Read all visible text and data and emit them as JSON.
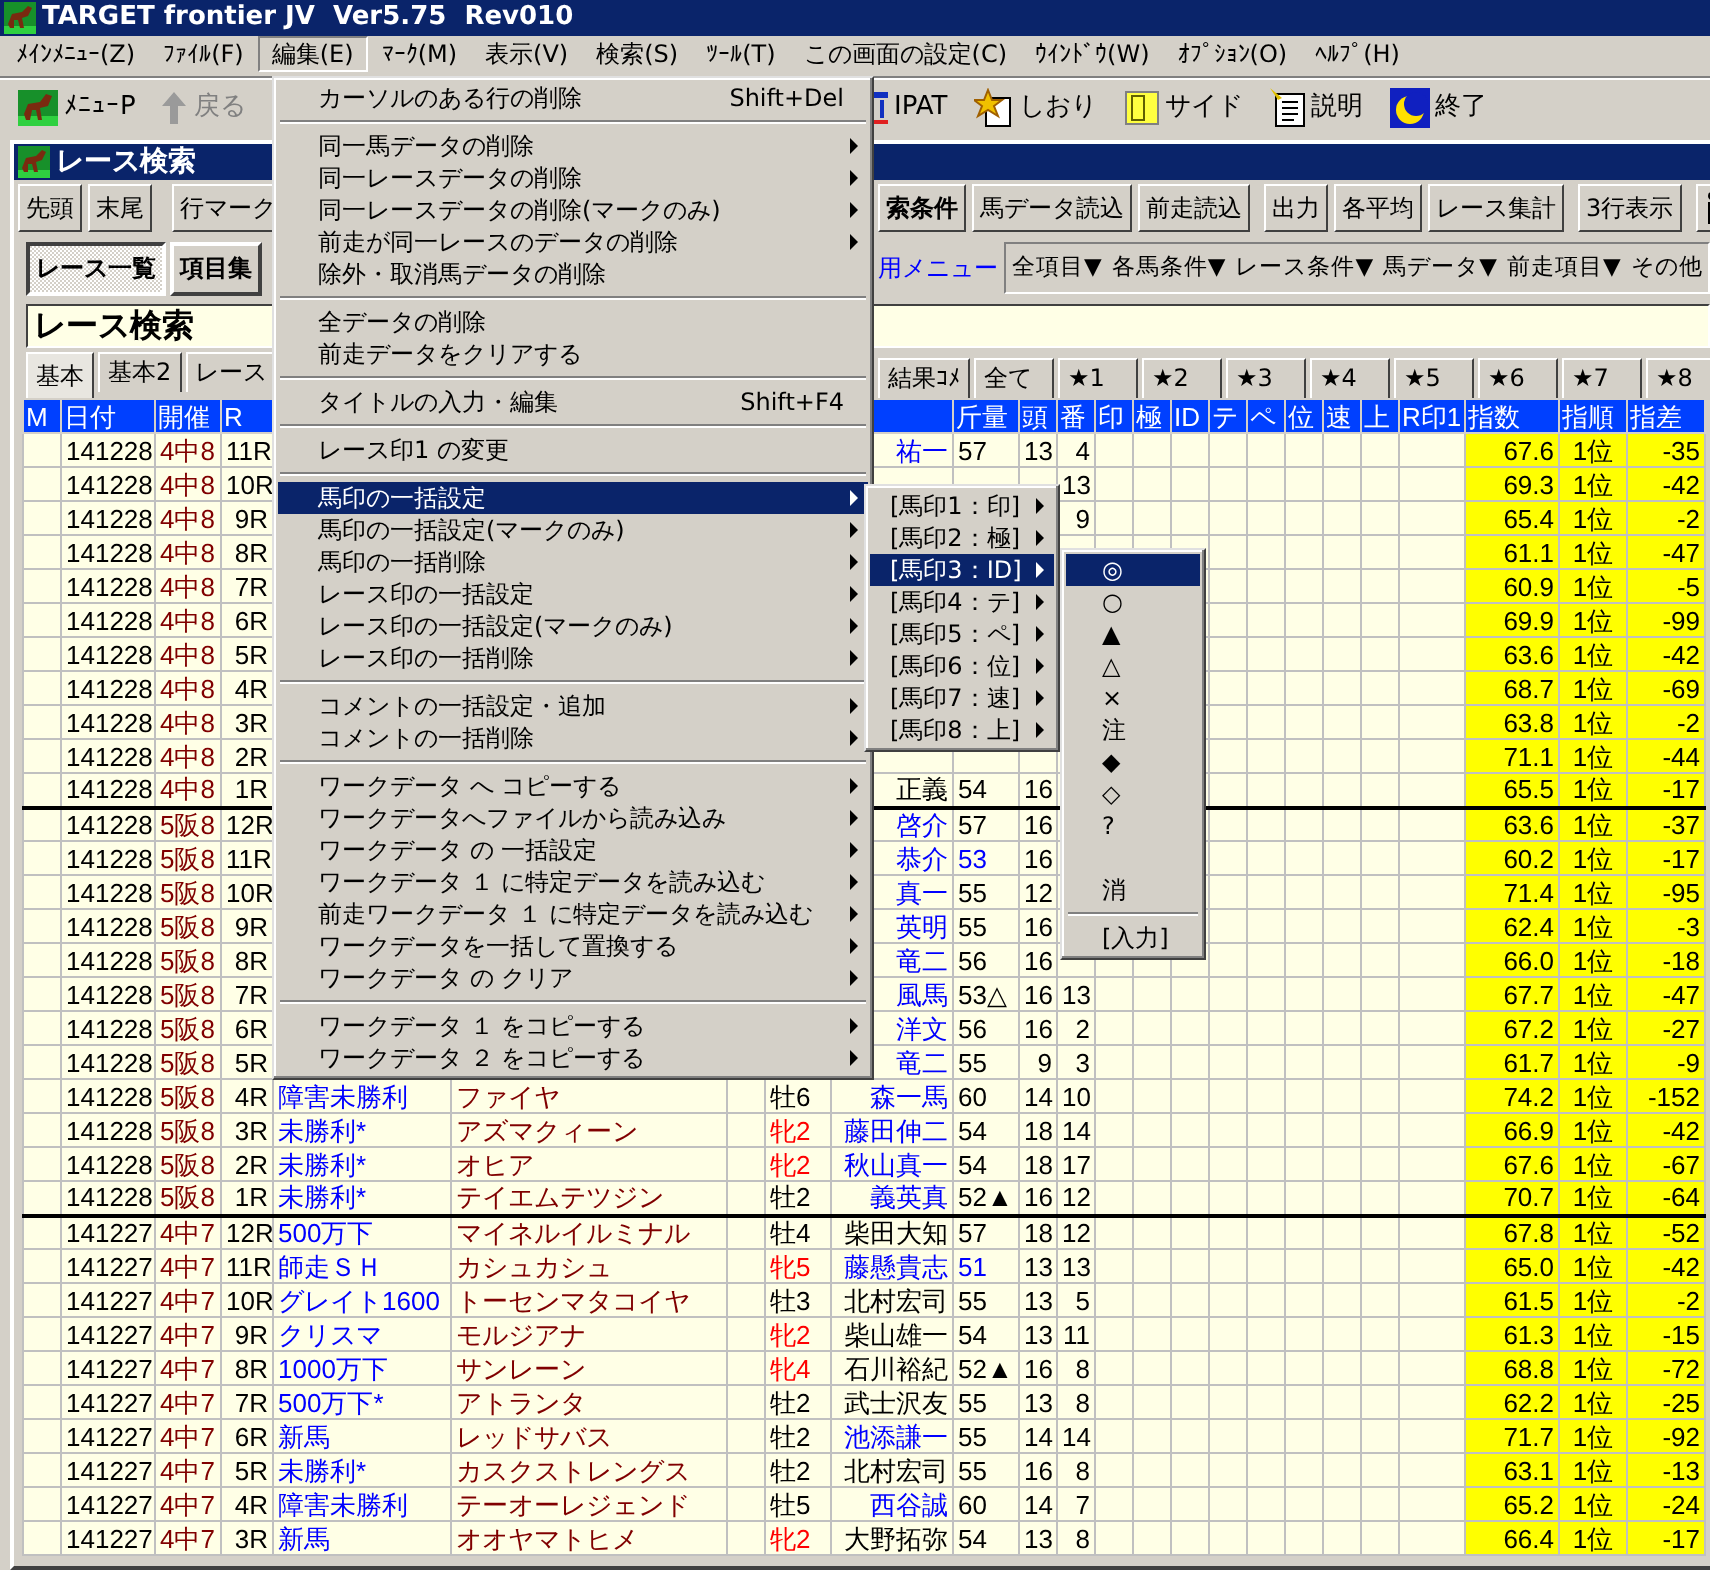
{
  "window": {
    "title": "TARGET frontier JV  Ver5.75  Rev010"
  },
  "menu_bar": [
    {
      "label": "ﾒｲﾝﾒﾆｭｰ(Z)",
      "selected": false
    },
    {
      "label": "ﾌｧｲﾙ(F)",
      "selected": false
    },
    {
      "label": "編集(E)",
      "selected": true
    },
    {
      "label": "ﾏｰｸ(M)",
      "selected": false
    },
    {
      "label": "表示(V)",
      "selected": false
    },
    {
      "label": "検索(S)",
      "selected": false
    },
    {
      "label": "ﾂｰﾙ(T)",
      "selected": false
    },
    {
      "label": "この画面の設定(C)",
      "selected": false
    },
    {
      "label": "ｳｲﾝﾄﾞｳ(W)",
      "selected": false
    },
    {
      "label": "ｵﾌﾟｼｮﾝ(O)",
      "selected": false
    },
    {
      "label": "ﾍﾙﾌﾟ(H)",
      "selected": false
    }
  ],
  "toolbar": {
    "left": [
      {
        "label": "ﾒﾆｭｰP",
        "kind": "menu",
        "disabled": false
      },
      {
        "label": "戻る",
        "kind": "back",
        "disabled": true
      }
    ],
    "right": [
      {
        "label": "IPAT",
        "kind": "ipat",
        "disabled": false
      },
      {
        "label": "しおり",
        "kind": "bookmark",
        "disabled": false
      },
      {
        "label": "サイド",
        "kind": "side",
        "disabled": false
      },
      {
        "label": "説明",
        "kind": "help",
        "disabled": false
      },
      {
        "label": "終了",
        "kind": "exit",
        "disabled": false
      }
    ]
  },
  "inner_window": {
    "title": "レース検索"
  },
  "button_groups_left": [
    [
      {
        "label": "先頭",
        "bold": false
      },
      {
        "label": "末尾",
        "bold": false
      }
    ],
    [
      {
        "label": "行マーク",
        "bold": false
      }
    ]
  ],
  "button_groups_right": [
    [
      {
        "label": "索条件",
        "bold": true
      },
      {
        "label": "馬データ読込",
        "bold": false
      },
      {
        "label": "前走読込",
        "bold": false
      }
    ],
    [
      {
        "label": "出力",
        "bold": false
      },
      {
        "label": "各平均",
        "bold": false
      },
      {
        "label": "レース集計",
        "bold": false
      }
    ],
    [
      {
        "label": "3行表示",
        "bold": false
      }
    ],
    [
      {
        "kind": "icon"
      }
    ]
  ],
  "view_tabs": [
    {
      "label": "レース一覧",
      "selected": true
    },
    {
      "label": "項目集",
      "selected": false
    }
  ],
  "menu_link": "用メニュー",
  "dropdowns": [
    "全項目▼",
    "各馬条件▼",
    "レース条件▼",
    "馬データ▼",
    "前走項目▼",
    "その他"
  ],
  "title_field": {
    "value": "レース検索"
  },
  "data_tabs_left": [
    {
      "label": "基本",
      "selected": true
    },
    {
      "label": "基本2",
      "selected": false
    },
    {
      "label": "レース",
      "selected": false
    }
  ],
  "data_tabs_right": [
    {
      "label": "結果ｺﾒ",
      "selected": false
    },
    {
      "label": "全て",
      "selected": false
    },
    {
      "label": "★1",
      "selected": false
    },
    {
      "label": "★2",
      "selected": false
    },
    {
      "label": "★3",
      "selected": false
    },
    {
      "label": "★4",
      "selected": false
    },
    {
      "label": "★5",
      "selected": false
    },
    {
      "label": "★6",
      "selected": false
    },
    {
      "label": "★7",
      "selected": false
    },
    {
      "label": "★8",
      "selected": false
    }
  ],
  "table": {
    "columns": [
      "M",
      "日付",
      "開催",
      "R",
      null,
      null,
      null,
      null,
      null,
      "斤量",
      "頭",
      "番",
      "印",
      "極",
      "ID",
      "テ",
      "ペ",
      "位",
      "速",
      "上",
      "R印1",
      "指数",
      "指順",
      "指差"
    ],
    "rows": [
      {
        "divider": false,
        "cells": [
          null,
          "141228",
          "4中8",
          "11R",
          null,
          null,
          null,
          null,
          {
            "text": "祐一",
            "color": "#0000ff"
          },
          "57",
          "13",
          "4",
          null,
          null,
          null,
          null,
          null,
          null,
          null,
          null,
          null,
          "67.6",
          "1位",
          "-35"
        ]
      },
      {
        "divider": false,
        "cells": [
          null,
          "141228",
          "4中8",
          "10R",
          null,
          null,
          null,
          null,
          null,
          null,
          null,
          "13",
          null,
          null,
          null,
          null,
          null,
          null,
          null,
          null,
          null,
          "69.3",
          "1位",
          "-42"
        ]
      },
      {
        "divider": false,
        "cells": [
          null,
          "141228",
          "4中8",
          "9R",
          null,
          null,
          null,
          null,
          null,
          null,
          null,
          "9",
          null,
          null,
          null,
          null,
          null,
          null,
          null,
          null,
          null,
          "65.4",
          "1位",
          "-2"
        ]
      },
      {
        "divider": false,
        "cells": [
          null,
          "141228",
          "4中8",
          "8R",
          null,
          null,
          null,
          null,
          null,
          null,
          null,
          null,
          null,
          null,
          null,
          null,
          null,
          null,
          null,
          null,
          null,
          "61.1",
          "1位",
          "-47"
        ]
      },
      {
        "divider": false,
        "cells": [
          null,
          "141228",
          "4中8",
          "7R",
          null,
          null,
          null,
          null,
          null,
          null,
          null,
          null,
          null,
          null,
          null,
          null,
          null,
          null,
          null,
          null,
          null,
          "60.9",
          "1位",
          "-5"
        ]
      },
      {
        "divider": false,
        "cells": [
          null,
          "141228",
          "4中8",
          "6R",
          null,
          null,
          null,
          null,
          null,
          null,
          null,
          null,
          null,
          null,
          null,
          null,
          null,
          null,
          null,
          null,
          null,
          "69.9",
          "1位",
          "-99"
        ]
      },
      {
        "divider": false,
        "cells": [
          null,
          "141228",
          "4中8",
          "5R",
          null,
          null,
          null,
          null,
          null,
          null,
          null,
          null,
          null,
          null,
          null,
          null,
          null,
          null,
          null,
          null,
          null,
          "63.6",
          "1位",
          "-42"
        ]
      },
      {
        "divider": false,
        "cells": [
          null,
          "141228",
          "4中8",
          "4R",
          null,
          null,
          null,
          null,
          null,
          null,
          null,
          null,
          null,
          null,
          null,
          null,
          null,
          null,
          null,
          null,
          null,
          "68.7",
          "1位",
          "-69"
        ]
      },
      {
        "divider": false,
        "cells": [
          null,
          "141228",
          "4中8",
          "3R",
          null,
          null,
          null,
          null,
          null,
          null,
          null,
          null,
          null,
          null,
          null,
          null,
          null,
          null,
          null,
          null,
          null,
          "63.8",
          "1位",
          "-2"
        ]
      },
      {
        "divider": false,
        "cells": [
          null,
          "141228",
          "4中8",
          "2R",
          null,
          null,
          null,
          null,
          null,
          null,
          null,
          null,
          null,
          null,
          null,
          null,
          null,
          null,
          null,
          null,
          null,
          "71.1",
          "1位",
          "-44"
        ]
      },
      {
        "divider": false,
        "cells": [
          null,
          "141228",
          "4中8",
          "1R",
          null,
          null,
          null,
          null,
          "正義",
          "54",
          "16",
          null,
          null,
          null,
          null,
          null,
          null,
          null,
          null,
          null,
          null,
          "65.5",
          "1位",
          "-17"
        ]
      },
      {
        "divider": true,
        "cells": [
          null,
          "141228",
          "5阪8",
          "12R",
          null,
          null,
          null,
          null,
          {
            "text": "啓介",
            "color": "#0000ff"
          },
          "57",
          "16",
          null,
          null,
          null,
          null,
          null,
          null,
          null,
          null,
          null,
          null,
          "63.6",
          "1位",
          "-37"
        ]
      },
      {
        "divider": false,
        "cells": [
          null,
          "141228",
          "5阪8",
          "11R",
          null,
          null,
          null,
          null,
          {
            "text": "恭介",
            "color": "#0000ff"
          },
          {
            "text": "53",
            "color": "#0000ff"
          },
          "16",
          null,
          null,
          null,
          null,
          null,
          null,
          null,
          null,
          null,
          null,
          "60.2",
          "1位",
          "-17"
        ]
      },
      {
        "divider": false,
        "cells": [
          null,
          "141228",
          "5阪8",
          "10R",
          null,
          null,
          null,
          null,
          {
            "text": "真一",
            "color": "#0000ff"
          },
          "55",
          "12",
          null,
          null,
          null,
          null,
          null,
          null,
          null,
          null,
          null,
          null,
          "71.4",
          "1位",
          "-95"
        ]
      },
      {
        "divider": false,
        "cells": [
          null,
          "141228",
          "5阪8",
          "9R",
          null,
          null,
          null,
          null,
          {
            "text": "英明",
            "color": "#0000ff"
          },
          "55",
          "16",
          null,
          null,
          null,
          null,
          null,
          null,
          null,
          null,
          null,
          null,
          "62.4",
          "1位",
          "-3"
        ]
      },
      {
        "divider": false,
        "cells": [
          null,
          "141228",
          "5阪8",
          "8R",
          null,
          null,
          null,
          null,
          {
            "text": "竜二",
            "color": "#0000ff"
          },
          "56",
          "16",
          null,
          null,
          null,
          null,
          null,
          null,
          null,
          null,
          null,
          null,
          "66.0",
          "1位",
          "-18"
        ]
      },
      {
        "divider": false,
        "cells": [
          null,
          "141228",
          "5阪8",
          "7R",
          null,
          null,
          null,
          null,
          {
            "text": "風馬",
            "color": "#0000ff"
          },
          "53△",
          "16",
          "13",
          null,
          null,
          null,
          null,
          null,
          null,
          null,
          null,
          null,
          "67.7",
          "1位",
          "-47"
        ]
      },
      {
        "divider": false,
        "cells": [
          null,
          "141228",
          "5阪8",
          "6R",
          null,
          null,
          null,
          null,
          {
            "text": "洋文",
            "color": "#0000ff"
          },
          "56",
          "16",
          "2",
          null,
          null,
          null,
          null,
          null,
          null,
          null,
          null,
          null,
          "67.2",
          "1位",
          "-27"
        ]
      },
      {
        "divider": false,
        "cells": [
          null,
          "141228",
          "5阪8",
          "5R",
          null,
          null,
          null,
          null,
          {
            "text": "竜二",
            "color": "#0000ff"
          },
          "55",
          "9",
          "3",
          null,
          null,
          null,
          null,
          null,
          null,
          null,
          null,
          null,
          "61.7",
          "1位",
          "-9"
        ]
      },
      {
        "divider": false,
        "cells": [
          null,
          "141228",
          "5阪8",
          "4R",
          "障害未勝利",
          "ファイヤ",
          null,
          "牡6",
          {
            "text": "森一馬",
            "color": "#0000ff"
          },
          "60",
          "14",
          "10",
          null,
          null,
          null,
          null,
          null,
          null,
          null,
          null,
          null,
          "74.2",
          "1位",
          "-152"
        ]
      },
      {
        "divider": false,
        "cells": [
          null,
          "141228",
          "5阪8",
          "3R",
          "未勝利*",
          "アズマクィーン",
          null,
          {
            "text": "牝2",
            "color": "#ff0000"
          },
          {
            "text": "藤田伸二",
            "color": "#0000ff"
          },
          "54",
          "18",
          "14",
          null,
          null,
          null,
          null,
          null,
          null,
          null,
          null,
          null,
          "66.9",
          "1位",
          "-42"
        ]
      },
      {
        "divider": false,
        "cells": [
          null,
          "141228",
          "5阪8",
          "2R",
          "未勝利*",
          "オヒア",
          null,
          {
            "text": "牝2",
            "color": "#ff0000"
          },
          {
            "text": "秋山真一",
            "color": "#0000ff"
          },
          "54",
          "18",
          "17",
          null,
          null,
          null,
          null,
          null,
          null,
          null,
          null,
          null,
          "67.6",
          "1位",
          "-67"
        ]
      },
      {
        "divider": false,
        "cells": [
          null,
          "141228",
          "5阪8",
          "1R",
          "未勝利*",
          "テイエムテツジン",
          null,
          "牡2",
          {
            "text": "義英真",
            "color": "#0000ff"
          },
          "52▲",
          "16",
          "12",
          null,
          null,
          null,
          null,
          null,
          null,
          null,
          null,
          null,
          "70.7",
          "1位",
          "-64"
        ]
      },
      {
        "divider": true,
        "cells": [
          null,
          "141227",
          "4中7",
          "12R",
          "500万下",
          "マイネルイルミナル",
          null,
          "牡4",
          "柴田大知",
          "57",
          "18",
          "12",
          null,
          null,
          null,
          null,
          null,
          null,
          null,
          null,
          null,
          "67.8",
          "1位",
          "-52"
        ]
      },
      {
        "divider": false,
        "cells": [
          null,
          "141227",
          "4中7",
          "11R",
          "師走ＳＨ",
          "カシュカシュ",
          null,
          {
            "text": "牝5",
            "color": "#ff0000"
          },
          {
            "text": "藤懸貴志",
            "color": "#0000ff"
          },
          {
            "text": "51",
            "color": "#0000ff"
          },
          "13",
          "13",
          null,
          null,
          null,
          null,
          null,
          null,
          null,
          null,
          null,
          "65.0",
          "1位",
          "-42"
        ]
      },
      {
        "divider": false,
        "cells": [
          null,
          "141227",
          "4中7",
          "10R",
          "グレイト1600",
          "トーセンマタコイヤ",
          null,
          "牡3",
          "北村宏司",
          "55",
          "13",
          "5",
          null,
          null,
          null,
          null,
          null,
          null,
          null,
          null,
          null,
          "61.5",
          "1位",
          "-2"
        ]
      },
      {
        "divider": false,
        "cells": [
          null,
          "141227",
          "4中7",
          "9R",
          "クリスマ",
          "モルジアナ",
          null,
          {
            "text": "牝2",
            "color": "#ff0000"
          },
          "柴山雄一",
          "54",
          "13",
          "11",
          null,
          null,
          null,
          null,
          null,
          null,
          null,
          null,
          null,
          "61.3",
          "1位",
          "-15"
        ]
      },
      {
        "divider": false,
        "cells": [
          null,
          "141227",
          "4中7",
          "8R",
          "1000万下",
          "サンレーン",
          null,
          {
            "text": "牝4",
            "color": "#ff0000"
          },
          "石川裕紀",
          "52▲",
          "16",
          "8",
          null,
          null,
          null,
          null,
          null,
          null,
          null,
          null,
          null,
          "68.8",
          "1位",
          "-72"
        ]
      },
      {
        "divider": false,
        "cells": [
          null,
          "141227",
          "4中7",
          "7R",
          "500万下*",
          "アトランタ",
          null,
          "牡2",
          "武士沢友",
          "55",
          "13",
          "8",
          null,
          null,
          null,
          null,
          null,
          null,
          null,
          null,
          null,
          "62.2",
          "1位",
          "-25"
        ]
      },
      {
        "divider": false,
        "cells": [
          null,
          "141227",
          "4中7",
          "6R",
          "新馬",
          "レッドサバス",
          null,
          "牡2",
          {
            "text": "池添謙一",
            "color": "#0000ff"
          },
          "55",
          "14",
          "14",
          null,
          null,
          null,
          null,
          null,
          null,
          null,
          null,
          null,
          "71.7",
          "1位",
          "-92"
        ]
      },
      {
        "divider": false,
        "cells": [
          null,
          "141227",
          "4中7",
          "5R",
          "未勝利*",
          "カスクストレングス",
          null,
          "牡2",
          "北村宏司",
          "55",
          "16",
          "8",
          null,
          null,
          null,
          null,
          null,
          null,
          null,
          null,
          null,
          "63.1",
          "1位",
          "-13"
        ]
      },
      {
        "divider": false,
        "cells": [
          null,
          "141227",
          "4中7",
          "4R",
          "障害未勝利",
          "テーオーレジェンド",
          null,
          "牡5",
          {
            "text": "西谷誠",
            "color": "#0000ff"
          },
          "60",
          "14",
          "7",
          null,
          null,
          null,
          null,
          null,
          null,
          null,
          null,
          null,
          "65.2",
          "1位",
          "-24"
        ]
      },
      {
        "divider": false,
        "cells": [
          null,
          "141227",
          "4中7",
          "3R",
          "新馬",
          "オオヤマトヒメ",
          null,
          {
            "text": "牝2",
            "color": "#ff0000"
          },
          "大野拓弥",
          "54",
          "13",
          "8",
          null,
          null,
          null,
          null,
          null,
          null,
          null,
          null,
          null,
          "66.4",
          "1位",
          "-17"
        ]
      }
    ]
  },
  "edit_menu": {
    "items": [
      {
        "kind": "item",
        "label": "カーソルのある行の削除",
        "shortcut": "Shift+Del",
        "submenu": false,
        "selected": false
      },
      {
        "kind": "separator"
      },
      {
        "kind": "item",
        "label": "同一馬データの削除",
        "submenu": true,
        "selected": false
      },
      {
        "kind": "item",
        "label": "同一レースデータの削除",
        "submenu": true,
        "selected": false
      },
      {
        "kind": "item",
        "label": "同一レースデータの削除(マークのみ)",
        "submenu": true,
        "selected": false
      },
      {
        "kind": "item",
        "label": "前走が同一レースのデータの削除",
        "submenu": true,
        "selected": false
      },
      {
        "kind": "item",
        "label": "除外・取消馬データの削除",
        "submenu": false,
        "selected": false
      },
      {
        "kind": "separator"
      },
      {
        "kind": "item",
        "label": "全データの削除",
        "submenu": false,
        "selected": false
      },
      {
        "kind": "item",
        "label": "前走データをクリアする",
        "submenu": false,
        "selected": false
      },
      {
        "kind": "separator"
      },
      {
        "kind": "item",
        "label": "タイトルの入力・編集",
        "shortcut": "Shift+F4",
        "submenu": false,
        "selected": false
      },
      {
        "kind": "separator"
      },
      {
        "kind": "item",
        "label": "レース印1 の変更",
        "submenu": false,
        "selected": false
      },
      {
        "kind": "separator"
      },
      {
        "kind": "item",
        "label": "馬印の一括設定",
        "submenu": true,
        "selected": true
      },
      {
        "kind": "item",
        "label": "馬印の一括設定(マークのみ)",
        "submenu": true,
        "selected": false
      },
      {
        "kind": "item",
        "label": "馬印の一括削除",
        "submenu": true,
        "selected": false
      },
      {
        "kind": "item",
        "label": "レース印の一括設定",
        "submenu": true,
        "selected": false
      },
      {
        "kind": "item",
        "label": "レース印の一括設定(マークのみ)",
        "submenu": true,
        "selected": false
      },
      {
        "kind": "item",
        "label": "レース印の一括削除",
        "submenu": true,
        "selected": false
      },
      {
        "kind": "separator"
      },
      {
        "kind": "item",
        "label": "コメントの一括設定・追加",
        "submenu": true,
        "selected": false
      },
      {
        "kind": "item",
        "label": "コメントの一括削除",
        "submenu": true,
        "selected": false
      },
      {
        "kind": "separator"
      },
      {
        "kind": "item",
        "label": "ワークデータ へ コピーする",
        "submenu": true,
        "selected": false
      },
      {
        "kind": "item",
        "label": "ワークデータへファイルから読み込み",
        "submenu": true,
        "selected": false
      },
      {
        "kind": "item",
        "label": "ワークデータ の 一括設定",
        "submenu": true,
        "selected": false
      },
      {
        "kind": "item",
        "label": "ワークデータ １ に特定データを読み込む",
        "submenu": true,
        "selected": false
      },
      {
        "kind": "item",
        "label": "前走ワークデータ １ に特定データを読み込む",
        "submenu": true,
        "selected": false
      },
      {
        "kind": "item",
        "label": "ワークデータを一括して置換する",
        "submenu": true,
        "selected": false
      },
      {
        "kind": "item",
        "label": "ワークデータ の クリア",
        "submenu": true,
        "selected": false
      },
      {
        "kind": "separator"
      },
      {
        "kind": "item",
        "label": "ワークデータ １ をコピーする",
        "submenu": true,
        "selected": false
      },
      {
        "kind": "item",
        "label": "ワークデータ ２ をコピーする",
        "submenu": true,
        "selected": false
      }
    ]
  },
  "mark_submenu": {
    "items": [
      {
        "kind": "item",
        "label": "[馬印1：印]",
        "submenu": true,
        "selected": false
      },
      {
        "kind": "item",
        "label": "[馬印2：極]",
        "submenu": true,
        "selected": false
      },
      {
        "kind": "item",
        "label": "[馬印3：ID]",
        "submenu": true,
        "selected": true
      },
      {
        "kind": "item",
        "label": "[馬印4：テ]",
        "submenu": true,
        "selected": false
      },
      {
        "kind": "item",
        "label": "[馬印5：ペ]",
        "submenu": true,
        "selected": false
      },
      {
        "kind": "item",
        "label": "[馬印6：位]",
        "submenu": true,
        "selected": false
      },
      {
        "kind": "item",
        "label": "[馬印7：速]",
        "submenu": true,
        "selected": false
      },
      {
        "kind": "item",
        "label": "[馬印8：上]",
        "submenu": true,
        "selected": false
      }
    ]
  },
  "symbol_submenu": {
    "items": [
      {
        "kind": "item",
        "label": "◎",
        "submenu": false,
        "selected": true
      },
      {
        "kind": "item",
        "label": "○",
        "submenu": false,
        "selected": false
      },
      {
        "kind": "item",
        "label": "▲",
        "submenu": false,
        "selected": false
      },
      {
        "kind": "item",
        "label": "△",
        "submenu": false,
        "selected": false
      },
      {
        "kind": "item",
        "label": "×",
        "submenu": false,
        "selected": false
      },
      {
        "kind": "item",
        "label": "注",
        "submenu": false,
        "selected": false
      },
      {
        "kind": "item",
        "label": "◆",
        "submenu": false,
        "selected": false
      },
      {
        "kind": "item",
        "label": "◇",
        "submenu": false,
        "selected": false
      },
      {
        "kind": "item",
        "label": "?",
        "submenu": false,
        "selected": false
      },
      {
        "kind": "gap"
      },
      {
        "kind": "item",
        "label": "消",
        "submenu": false,
        "selected": false
      },
      {
        "kind": "separator"
      },
      {
        "kind": "item",
        "label": "[入力]",
        "submenu": false,
        "selected": false
      }
    ]
  }
}
